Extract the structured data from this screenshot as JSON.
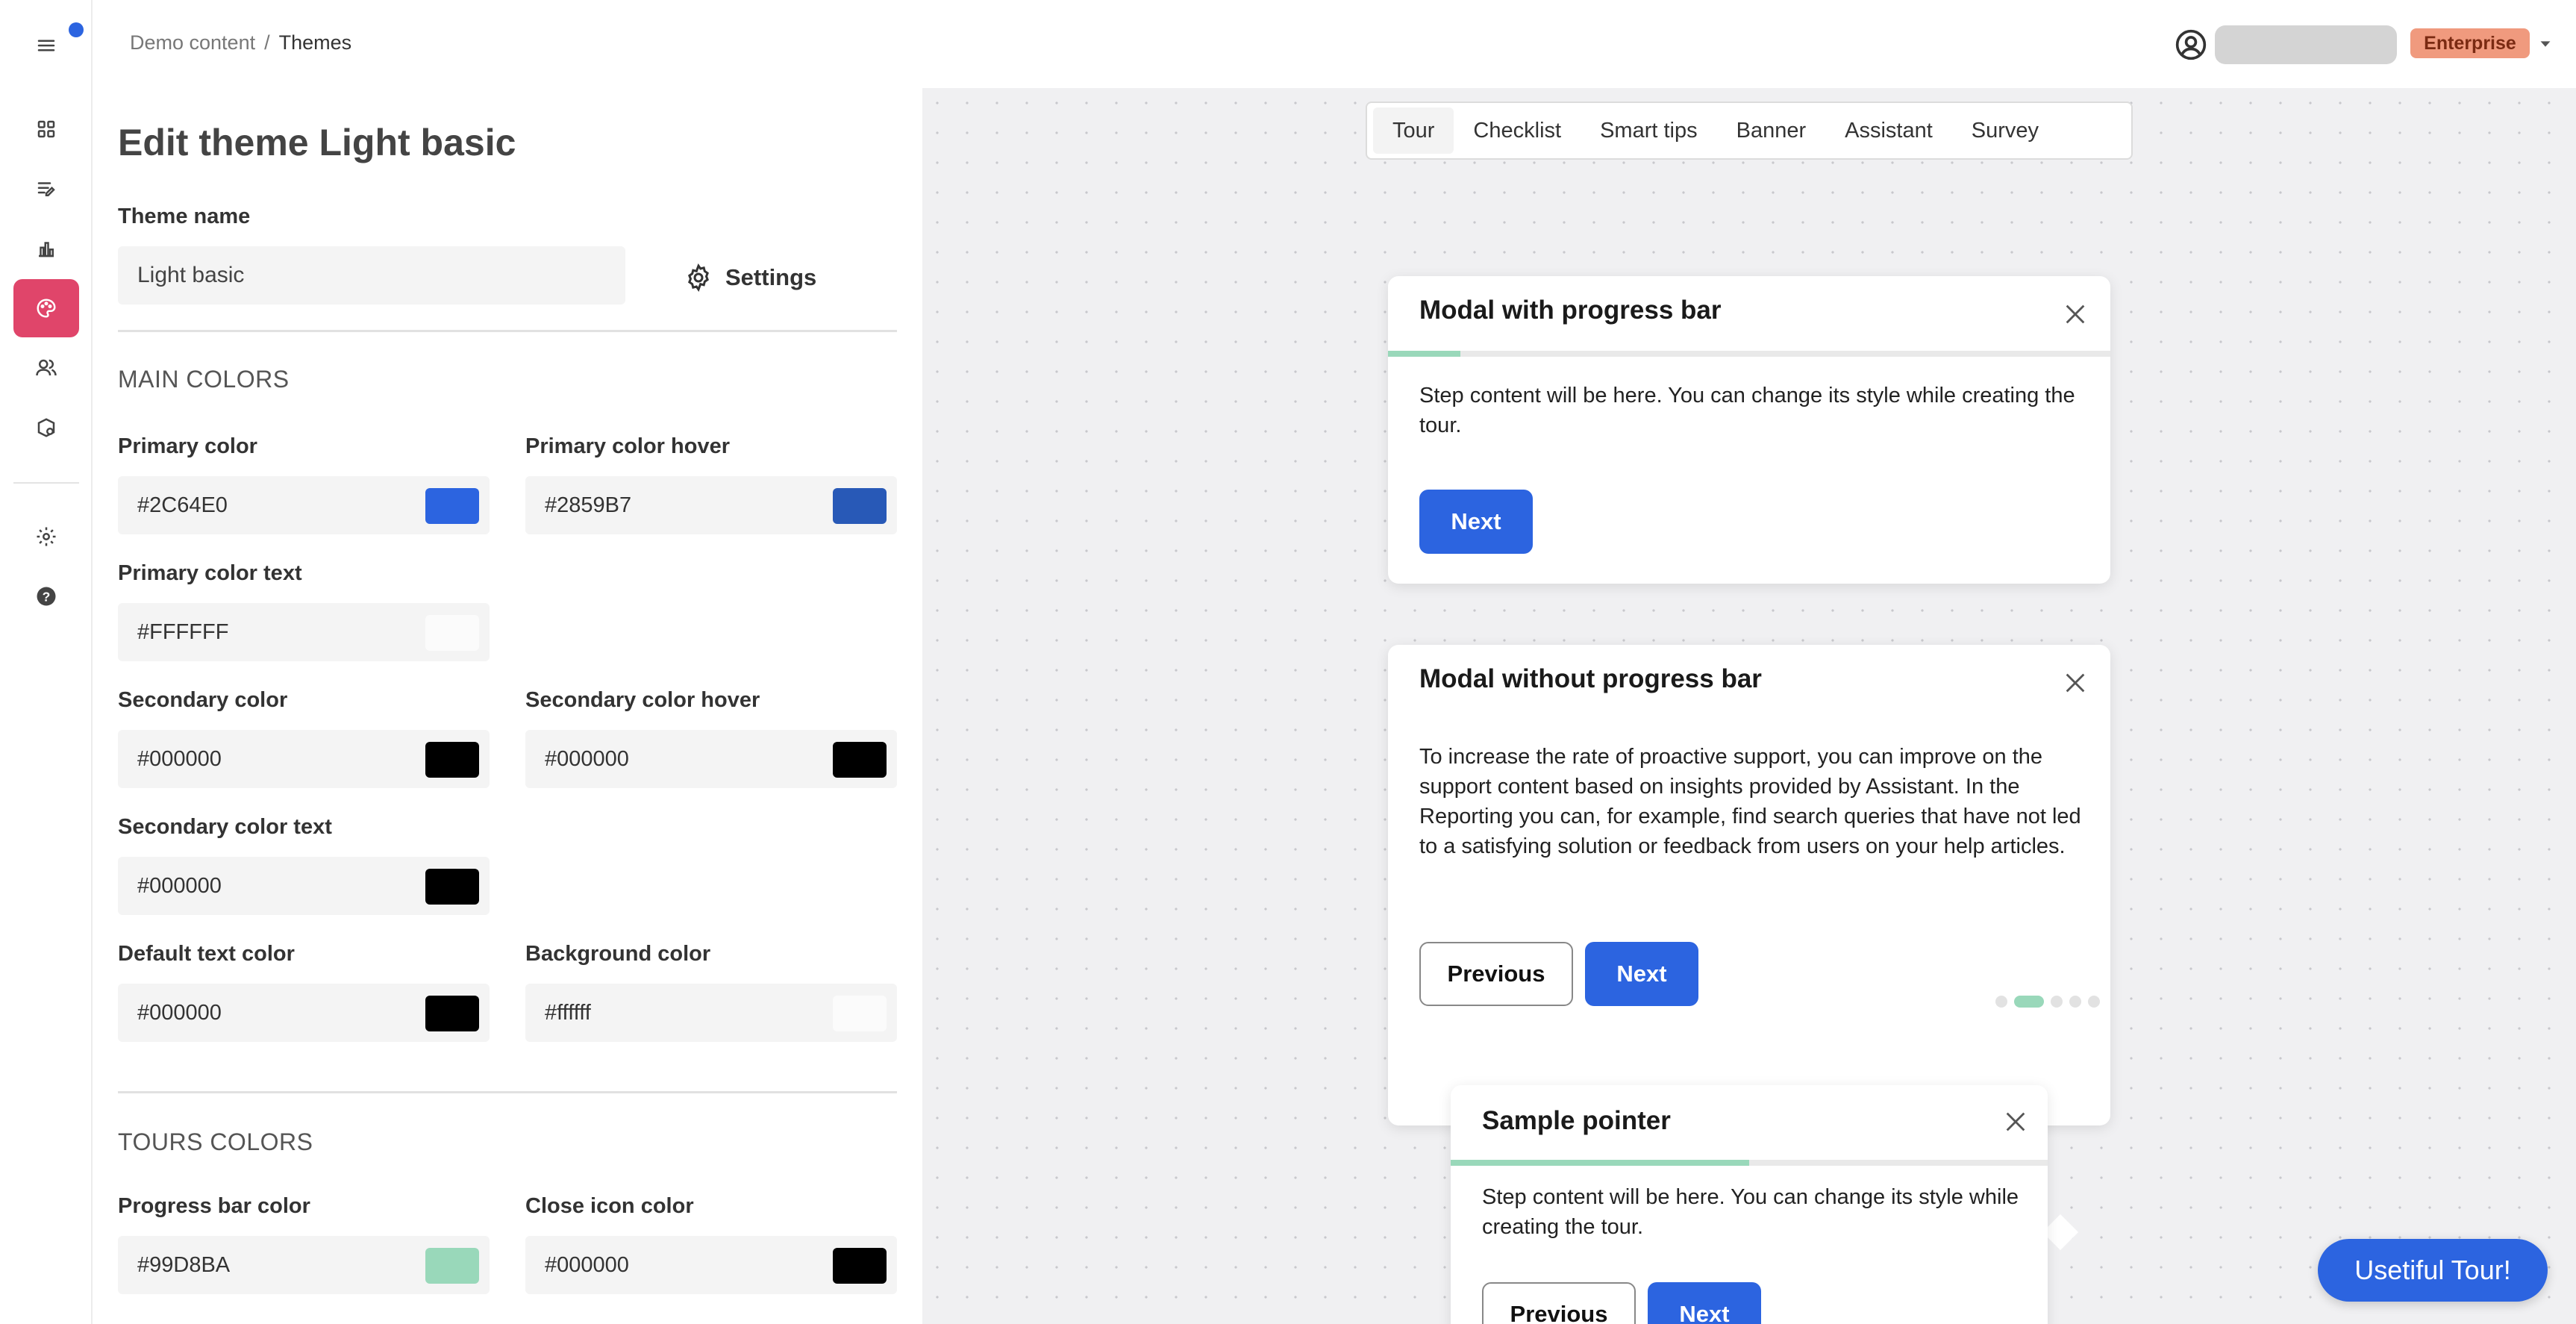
{
  "breadcrumb": {
    "parent": "Demo content",
    "separator": "/",
    "current": "Themes"
  },
  "sidebar": {
    "items": [
      {
        "icon": "menu-icon"
      },
      {
        "icon": "dashboard-icon"
      },
      {
        "icon": "content-icon"
      },
      {
        "icon": "chart-icon"
      },
      {
        "icon": "palette-icon",
        "active": true
      },
      {
        "icon": "users-icon"
      },
      {
        "icon": "integrations-icon"
      },
      {
        "icon": "gear-icon"
      },
      {
        "icon": "help-icon"
      }
    ],
    "notification_color": "#2c64e0"
  },
  "header": {
    "plan_badge": "Enterprise"
  },
  "editor": {
    "title": "Edit theme Light basic",
    "theme_name_label": "Theme name",
    "theme_name_value": "Light basic",
    "settings_label": "Settings",
    "main_colors_title": "MAIN COLORS",
    "tours_colors_title": "TOURS COLORS",
    "fields": {
      "primary_color": {
        "label": "Primary color",
        "value": "#2C64E0",
        "swatch": "#2c64e0"
      },
      "primary_color_hover": {
        "label": "Primary color hover",
        "value": "#2859B7",
        "swatch": "#2859b7"
      },
      "primary_color_text": {
        "label": "Primary color text",
        "value": "#FFFFFF",
        "swatch": "#ffffff"
      },
      "secondary_color": {
        "label": "Secondary color",
        "value": "#000000",
        "swatch": "#000000"
      },
      "secondary_color_hover": {
        "label": "Secondary color hover",
        "value": "#000000",
        "swatch": "#000000"
      },
      "secondary_color_text": {
        "label": "Secondary color text",
        "value": "#000000",
        "swatch": "#000000"
      },
      "default_text_color": {
        "label": "Default text color",
        "value": "#000000",
        "swatch": "#000000"
      },
      "background_color": {
        "label": "Background color",
        "value": "#ffffff",
        "swatch": "#ffffff"
      },
      "progress_bar_color": {
        "label": "Progress bar color",
        "value": "#99D8BA",
        "swatch": "#99d8ba"
      },
      "close_icon_color": {
        "label": "Close icon color",
        "value": "#000000",
        "swatch": "#000000"
      }
    }
  },
  "preview": {
    "tabs": [
      "Tour",
      "Checklist",
      "Smart tips",
      "Banner",
      "Assistant",
      "Survey"
    ],
    "active_tab": "Tour",
    "modal_progress": {
      "title": "Modal with progress bar",
      "body": "Step content will be here. You can change its style while creating the tour.",
      "next_label": "Next",
      "progress": 0.1
    },
    "modal_no_progress": {
      "title": "Modal without progress bar",
      "body": "To increase the rate of proactive support, you can improve on the support content based on insights provided by Assistant. In the Reporting you can, for example, find search queries that have not led to a satisfying solution or feedback from users on your help articles.",
      "previous_label": "Previous",
      "next_label": "Next",
      "step": 2,
      "total_steps": 5
    },
    "pointer": {
      "title": "Sample pointer",
      "body": "Step content will be here. You can change its style while creating the tour.",
      "previous_label": "Previous",
      "next_label": "Next",
      "progress": 0.5
    },
    "launcher_label": "Usetiful Tour!"
  }
}
